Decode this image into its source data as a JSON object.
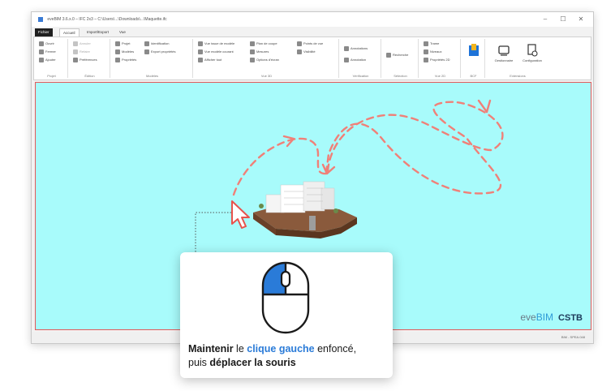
{
  "window": {
    "title": "eveBIM 3.6.x.0 – IFC 2x3 – C:\\Users\\...\\Downloads\\...\\Maquette.ifc",
    "controls": {
      "minimize": "–",
      "maximize": "☐",
      "close": "✕"
    }
  },
  "ribbon": {
    "tabs": [
      "Fichier",
      "Accueil",
      "Import/Export",
      "Vue"
    ],
    "active_tab": "Accueil",
    "groups": [
      {
        "name": "Projet",
        "items": [
          "Ouvrir",
          "Fermer",
          "Ajouter"
        ]
      },
      {
        "name": "Édition",
        "items": [
          "Annuler",
          "Refaire",
          "Préférences"
        ]
      },
      {
        "name": "Modèles",
        "items": [
          "Projet",
          "Modèles",
          "Propriétés",
          "Identification",
          "Export propriétés"
        ]
      },
      {
        "name": "Vue 3D",
        "items": [
          "Vue issue de modèle",
          "Vue modèle courant",
          "Afficher tout",
          "Plan de coupe",
          "Mesures",
          "Options d'écran",
          "Points de vue",
          "Visibilité"
        ]
      },
      {
        "name": "Vérification",
        "items": [
          "Annotations",
          "Annotation"
        ]
      },
      {
        "name": "Sélection",
        "items": [
          "Recherche"
        ]
      },
      {
        "name": "Vue 2D",
        "items": [
          "Trame",
          "Niveaux",
          "Propriétés 2D"
        ]
      },
      {
        "name": "BCF",
        "items": [
          ""
        ]
      },
      {
        "name": "Extensions",
        "items": [
          "Gestionnaire",
          "Configuration"
        ]
      }
    ]
  },
  "statusbar": {
    "right": "BIM - SPEA.048"
  },
  "brand": {
    "eve": "eve",
    "bim": "BIM",
    "cstb": "CSTB"
  },
  "instruction": {
    "part1": "Maintenir",
    "part2": " le ",
    "part3": "clique gauche",
    "part4": " enfoncé,",
    "part5": "puis ",
    "part6": "déplacer la souris"
  },
  "colors": {
    "viewport_bg": "#a8fbfb",
    "viewport_border": "#e25a5a",
    "path_dash": "#f28b82",
    "mouse_left_button": "#2a7bd8",
    "highlight_text": "#2a7bd8"
  },
  "icons": [
    "cursor-arrow-icon",
    "mouse-icon",
    "building-model"
  ]
}
